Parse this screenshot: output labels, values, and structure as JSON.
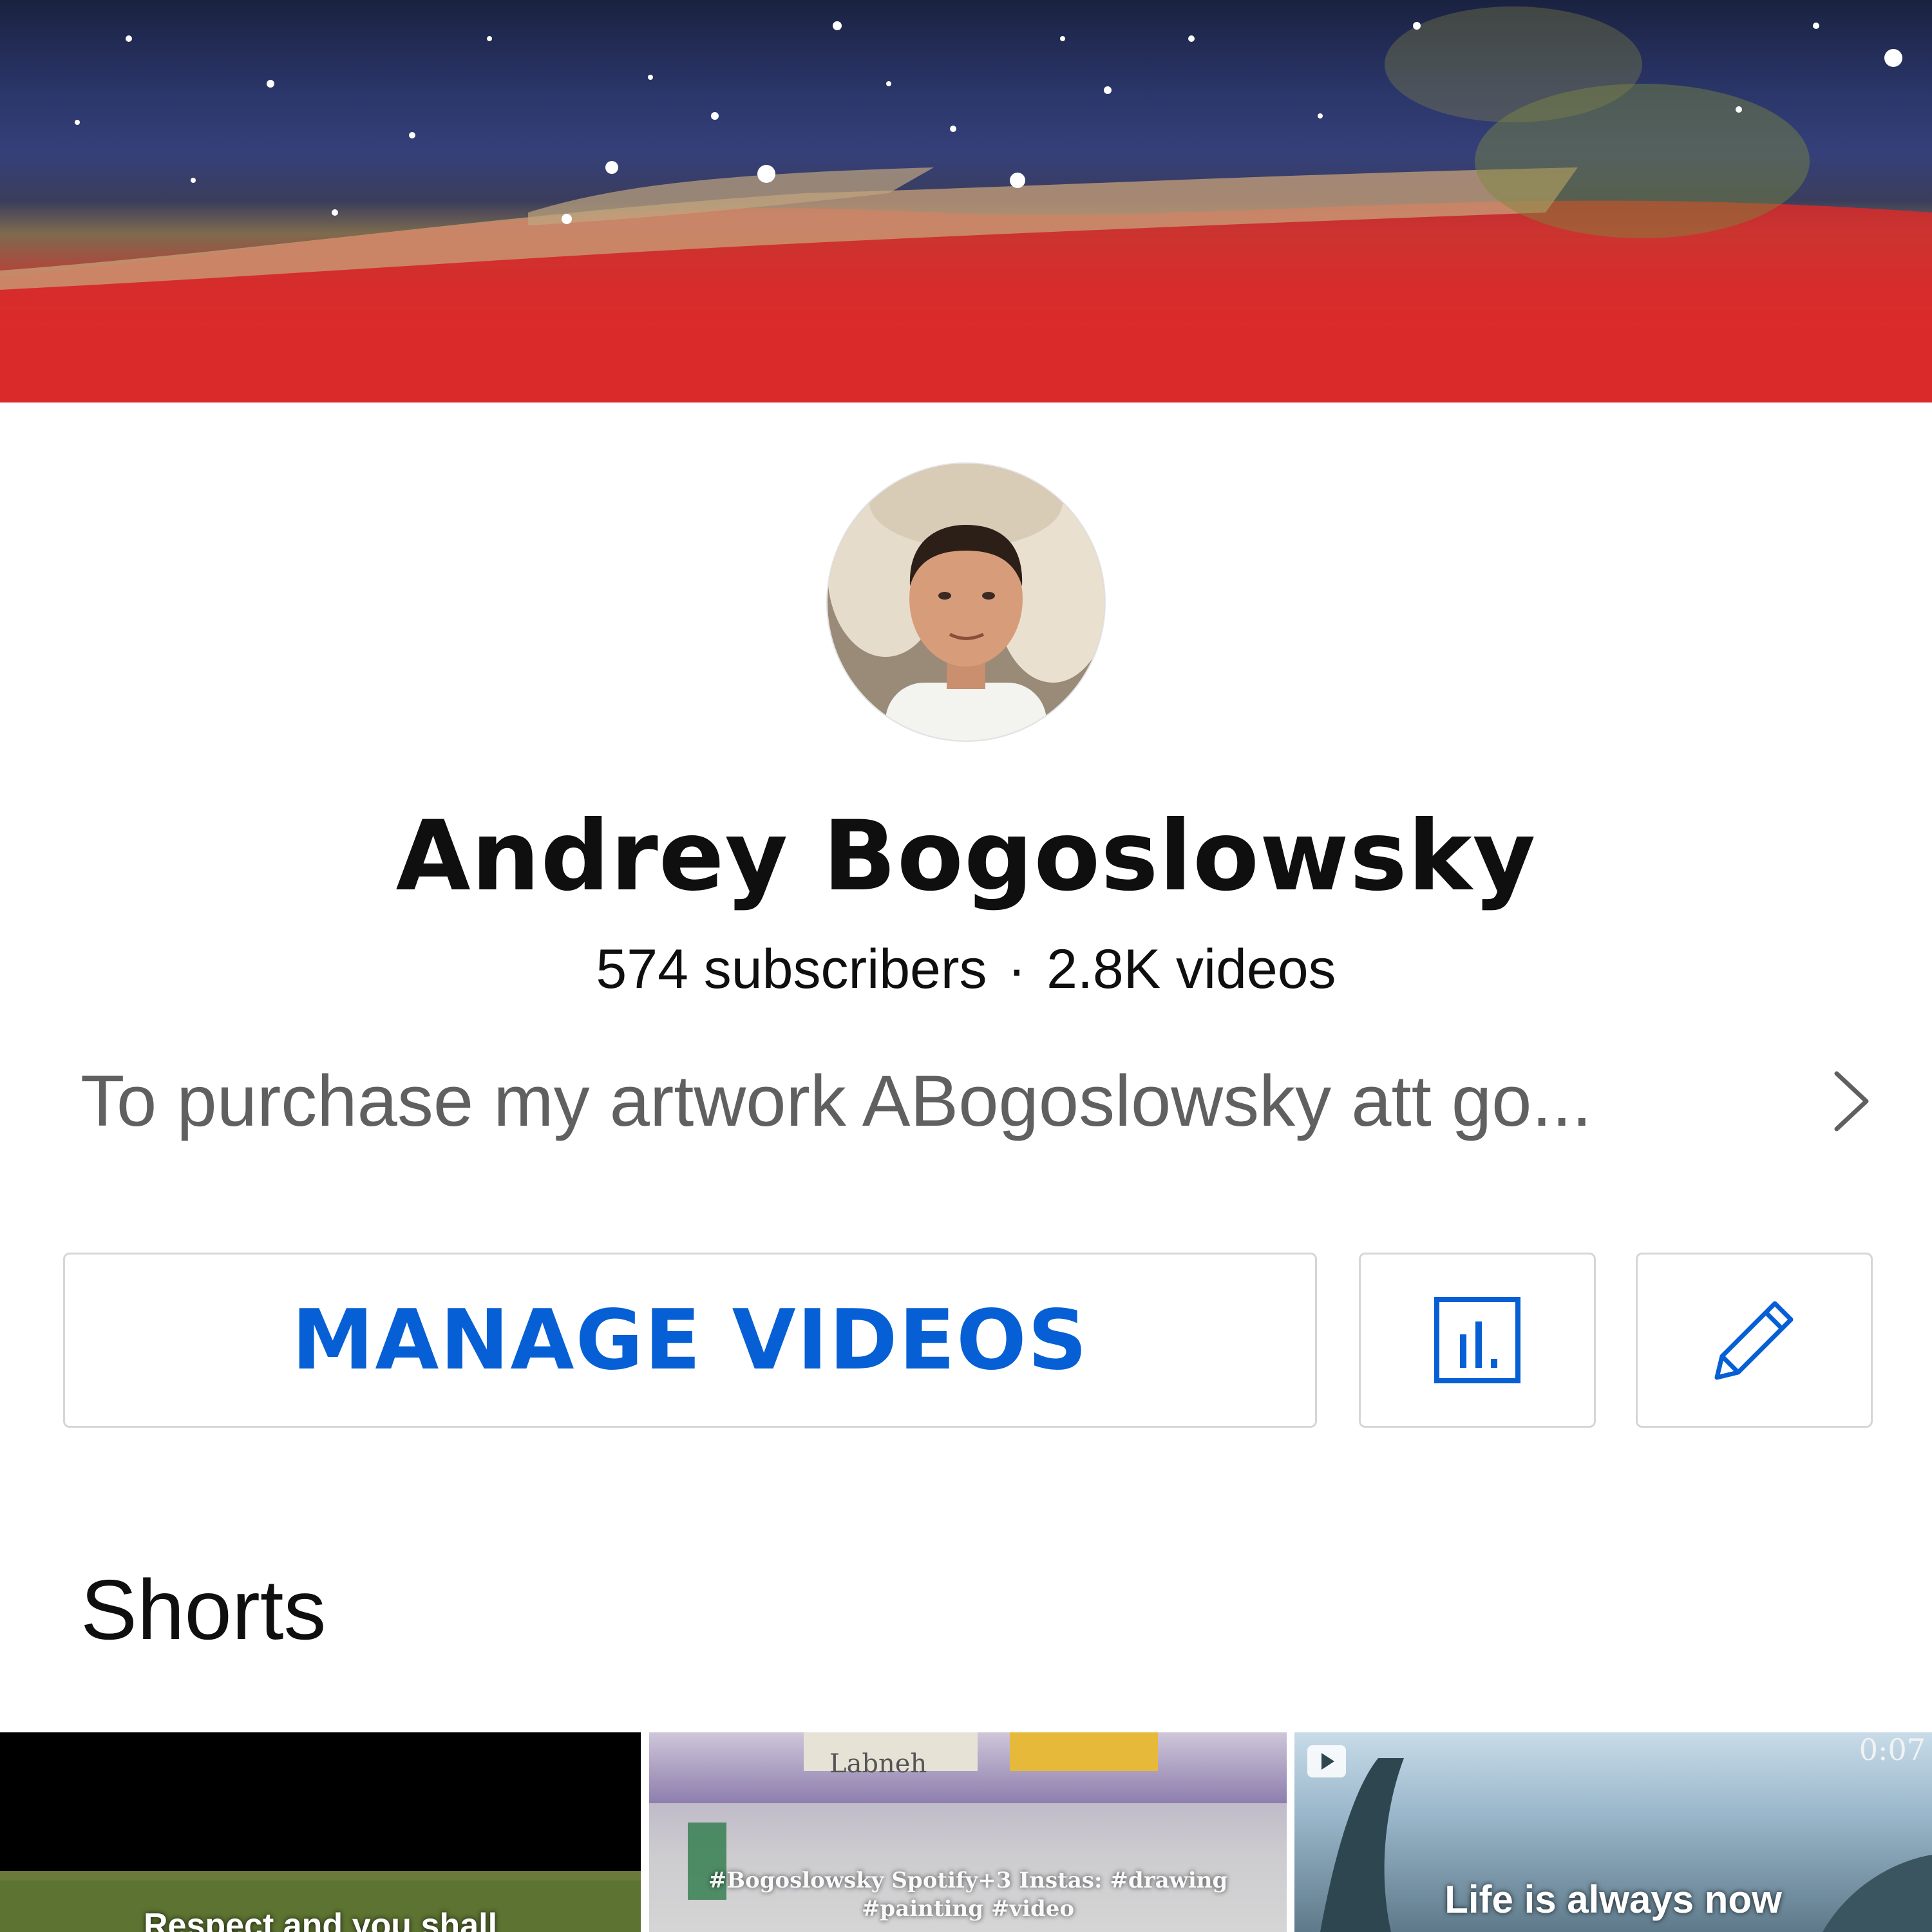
{
  "channel": {
    "name": "Andrey Bogoslowsky",
    "subscribers": "574 subscribers",
    "separator": "·",
    "videos": "2.8K videos",
    "description": "To purchase my artwork ABogoslowsky att go..."
  },
  "actions": {
    "manage_label": "MANAGE VIDEOS",
    "analytics_icon": "analytics-icon",
    "edit_icon": "pencil-icon"
  },
  "shorts": {
    "title": "Shorts",
    "items": [
      {
        "caption": "Respect and you shall"
      },
      {
        "caption": "#Bogoslowsky Spotify+3 Instas: #drawing #painting #video",
        "label": "Labneh"
      },
      {
        "caption": "Life is always now",
        "duration": "0:07"
      }
    ]
  },
  "colors": {
    "accent_blue": "#065fd4",
    "secondary_text": "#606060",
    "border": "#d6d6d6"
  }
}
